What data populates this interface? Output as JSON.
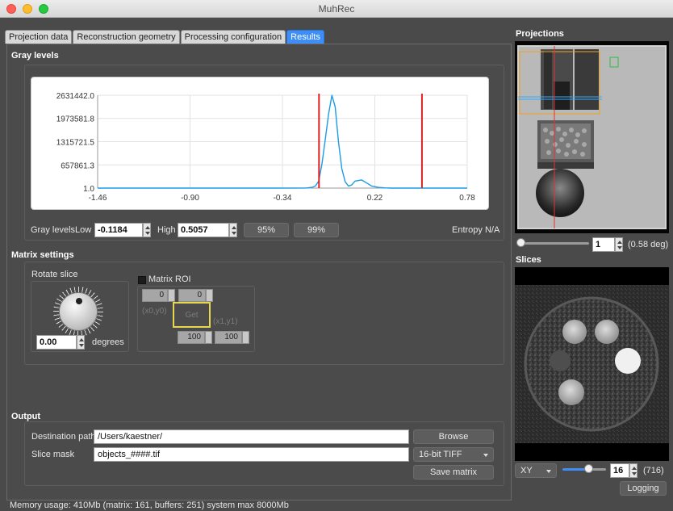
{
  "window": {
    "title": "MuhRec"
  },
  "tabs": [
    {
      "label": "Projection data"
    },
    {
      "label": "Reconstruction geometry"
    },
    {
      "label": "Processing configuration"
    },
    {
      "label": "Results"
    }
  ],
  "gray_levels": {
    "title": "Gray levels",
    "label": "Gray levels",
    "low_label": "Low",
    "low_value": "-0.1184",
    "high_label": "High",
    "high_value": "0.5057",
    "btn_95": "95%",
    "btn_99": "99%",
    "entropy": "Entropy N/A"
  },
  "chart_data": {
    "type": "line",
    "title": "",
    "xlabel": "",
    "ylabel": "",
    "x_ticks": [
      "-1.46",
      "-0.90",
      "-0.34",
      "0.22",
      "0.78"
    ],
    "y_ticks": [
      "1.0",
      "657861.3",
      "1315721.5",
      "1973581.8",
      "2631442.0"
    ],
    "xlim": [
      -1.46,
      0.78
    ],
    "ylim": [
      1.0,
      2631442.0
    ],
    "grid": true,
    "series": [
      {
        "color": "#1a9be8",
        "x": [
          -1.46,
          -0.4,
          -0.2,
          -0.16,
          -0.14,
          -0.12,
          -0.1,
          -0.08,
          -0.06,
          -0.04,
          -0.02,
          0.0,
          0.02,
          0.04,
          0.06,
          0.08,
          0.1,
          0.14,
          0.18,
          0.2,
          0.24,
          0.28,
          0.32,
          0.4,
          0.5,
          0.6,
          0.78
        ],
        "y": [
          1.0,
          1.0,
          2000,
          20000,
          60000,
          200000,
          700000,
          1400000,
          2100000,
          2630000,
          2300000,
          1300000,
          550000,
          180000,
          60000,
          90000,
          200000,
          230000,
          120000,
          60000,
          20000,
          6000,
          1000,
          1.0,
          1.0,
          1.0,
          1.0
        ]
      }
    ],
    "markers": [
      {
        "x": -0.1184,
        "color": "#dd2222"
      },
      {
        "x": 0.5057,
        "color": "#dd2222"
      }
    ]
  },
  "matrix": {
    "title": "Matrix settings",
    "rotate_label": "Rotate slice",
    "rotate_value": "0.00",
    "rotate_unit": "degrees",
    "roi_label": "Matrix ROI",
    "x0": "0",
    "y0": "0",
    "x0y0_label": "(x0,y0)",
    "get_label": "Get",
    "x1y1_label": "(x1,y1)",
    "x1": "100",
    "y1": "100"
  },
  "output": {
    "title": "Output",
    "dest_label": "Destination path",
    "dest_value": "/Users/kaestner/",
    "browse": "Browse",
    "mask_label": "Slice mask",
    "mask_value": "objects_####.tif",
    "format": "16-bit TIFF",
    "save_matrix": "Save matrix"
  },
  "projections": {
    "title": "Projections",
    "index": "1",
    "angle": "(0.58 deg)"
  },
  "slices": {
    "title": "Slices",
    "plane": "XY",
    "index": "16",
    "count": "(716)",
    "logging": "Logging"
  },
  "status": {
    "text": "Memory usage: 410Mb (matrix: 161, buffers: 251) system max 8000Mb"
  }
}
